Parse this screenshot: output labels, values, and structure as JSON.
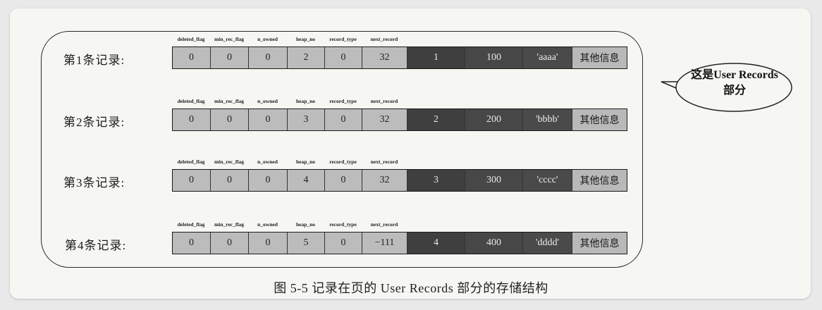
{
  "field_names": [
    "deleted_flag",
    "min_rec_flag",
    "n_owned",
    "heap_no",
    "record_type",
    "next_record"
  ],
  "records": [
    {
      "label": "第1条记录:",
      "header": [
        "0",
        "0",
        "0",
        "2",
        "0",
        "32"
      ],
      "id": "1",
      "value": "100",
      "name": "'aaaa'",
      "other": "其他信息"
    },
    {
      "label": "第2条记录:",
      "header": [
        "0",
        "0",
        "0",
        "3",
        "0",
        "32"
      ],
      "id": "2",
      "value": "200",
      "name": "'bbbb'",
      "other": "其他信息"
    },
    {
      "label": "第3条记录:",
      "header": [
        "0",
        "0",
        "0",
        "4",
        "0",
        "32"
      ],
      "id": "3",
      "value": "300",
      "name": "'cccc'",
      "other": "其他信息"
    },
    {
      "label": "第4条记录:",
      "header": [
        "0",
        "0",
        "0",
        "5",
        "0",
        "−111"
      ],
      "id": "4",
      "value": "400",
      "name": "'dddd'",
      "other": "其他信息"
    }
  ],
  "callout": {
    "line1": "这是User Records",
    "line2": "部分"
  },
  "caption": "图 5-5   记录在页的 User Records 部分的存储结构"
}
